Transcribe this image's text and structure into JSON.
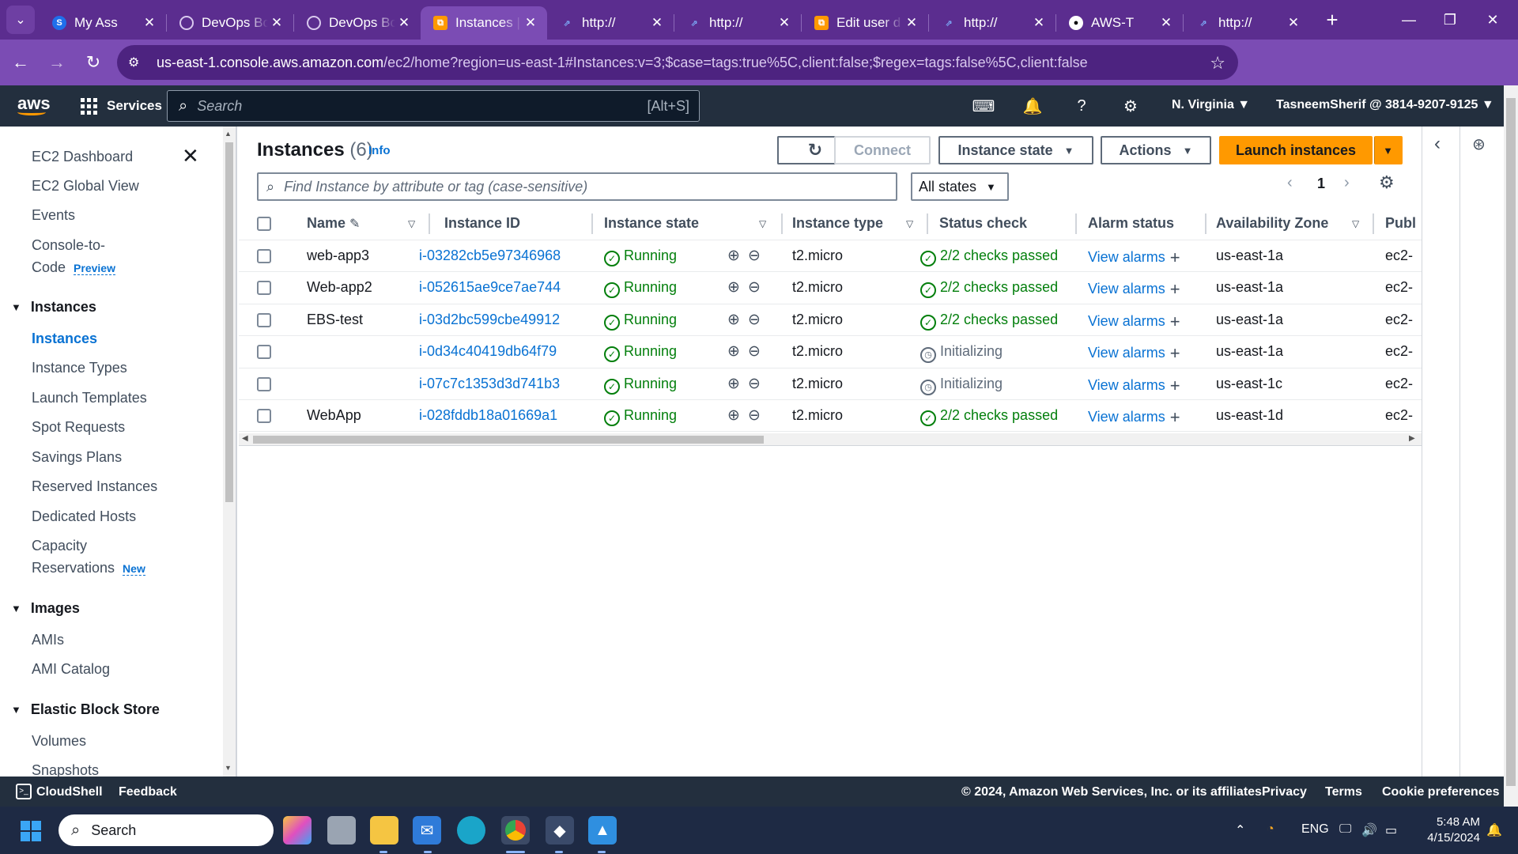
{
  "browser": {
    "tabs": [
      {
        "title": "My Ass",
        "icon": "s-icon"
      },
      {
        "title": "DevOps Bo",
        "icon": "globe-icon"
      },
      {
        "title": "DevOps Bo",
        "icon": "globe-icon"
      },
      {
        "title": "Instances |",
        "icon": "aws-icon",
        "active": true
      },
      {
        "title": "http://",
        "icon": "link-icon"
      },
      {
        "title": "http://",
        "icon": "link-icon"
      },
      {
        "title": "Edit user d",
        "icon": "aws-icon"
      },
      {
        "title": "http://",
        "icon": "link-icon"
      },
      {
        "title": "AWS-T",
        "icon": "github-icon"
      },
      {
        "title": "http://",
        "icon": "link-icon"
      }
    ],
    "url_host": "us-east-1.console.aws.amazon.com",
    "url_rest": "/ec2/home?region=us-east-1#Instances:v=3;$case=tags:true%5C,client:false;$regex=tags:false%5C,client:false"
  },
  "awsnav": {
    "services_label": "Services",
    "search_placeholder": "Search",
    "search_shortcut": "[Alt+S]",
    "region": "N. Virginia ▼",
    "account": "TasneemSherif @ 3814-9207-9125 ▼"
  },
  "sidebar": {
    "top_items": [
      "EC2 Dashboard",
      "EC2 Global View",
      "Events"
    ],
    "console_to_code": {
      "line1": "Console-to-",
      "line2": "Code",
      "badge": "Preview"
    },
    "instances_section": "Instances",
    "instance_items": [
      "Instances",
      "Instance Types",
      "Launch Templates",
      "Spot Requests",
      "Savings Plans",
      "Reserved Instances",
      "Dedicated Hosts"
    ],
    "capacity": {
      "line1": "Capacity",
      "line2": "Reservations",
      "badge": "New"
    },
    "images_section": "Images",
    "image_items": [
      "AMIs",
      "AMI Catalog"
    ],
    "ebs_section": "Elastic Block Store",
    "ebs_items": [
      "Volumes",
      "Snapshots"
    ]
  },
  "main": {
    "title": "Instances",
    "count": "(6)",
    "info": "Info",
    "buttons": {
      "connect": "Connect",
      "instance_state": "Instance state",
      "actions": "Actions",
      "launch": "Launch instances"
    },
    "filter_placeholder": "Find Instance by attribute or tag (case-sensitive)",
    "states_filter": "All states",
    "page": "1"
  },
  "table": {
    "columns": [
      "Name",
      "Instance ID",
      "Instance state",
      "Instance type",
      "Status check",
      "Alarm status",
      "Availability Zone",
      "Publ"
    ],
    "rows": [
      {
        "name": "web-app3",
        "id": "i-03282cb5e97346968",
        "state": "Running",
        "type": "t2.micro",
        "status": "2/2 checks passed",
        "status_ok": true,
        "alarm": "View alarms",
        "az": "us-east-1a",
        "public": "ec2-"
      },
      {
        "name": "Web-app2",
        "id": "i-052615ae9ce7ae744",
        "state": "Running",
        "type": "t2.micro",
        "status": "2/2 checks passed",
        "status_ok": true,
        "alarm": "View alarms",
        "az": "us-east-1a",
        "public": "ec2-"
      },
      {
        "name": "EBS-test",
        "id": "i-03d2bc599cbe49912",
        "state": "Running",
        "type": "t2.micro",
        "status": "2/2 checks passed",
        "status_ok": true,
        "alarm": "View alarms",
        "az": "us-east-1a",
        "public": "ec2-"
      },
      {
        "name": "",
        "id": "i-0d34c40419db64f79",
        "state": "Running",
        "type": "t2.micro",
        "status": "Initializing",
        "status_ok": false,
        "alarm": "View alarms",
        "az": "us-east-1a",
        "public": "ec2-"
      },
      {
        "name": "",
        "id": "i-07c7c1353d3d741b3",
        "state": "Running",
        "type": "t2.micro",
        "status": "Initializing",
        "status_ok": false,
        "alarm": "View alarms",
        "az": "us-east-1c",
        "public": "ec2-"
      },
      {
        "name": "WebApp",
        "id": "i-028fddb18a01669a1",
        "state": "Running",
        "type": "t2.micro",
        "status": "2/2 checks passed",
        "status_ok": true,
        "alarm": "View alarms",
        "az": "us-east-1d",
        "public": "ec2-"
      }
    ]
  },
  "footer": {
    "cloudshell": "CloudShell",
    "feedback": "Feedback",
    "copyright": "© 2024, Amazon Web Services, Inc. or its affiliates.",
    "privacy": "Privacy",
    "terms": "Terms",
    "cookies": "Cookie preferences"
  },
  "taskbar": {
    "search_placeholder": "Search",
    "lang": "ENG",
    "time": "5:48 AM",
    "date": "4/15/2024"
  },
  "colors": {
    "browser_frame": "#5b2d8f",
    "aws_nav": "#232f3e",
    "aws_orange": "#ff9900",
    "link_blue": "#0972d3",
    "success_green": "#037f0c"
  }
}
